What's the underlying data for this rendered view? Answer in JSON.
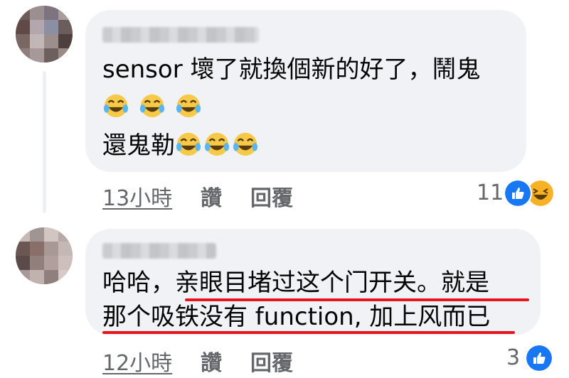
{
  "comments": [
    {
      "text_line_1": "sensor 壞了就換個新的好了，鬧鬼",
      "text_line_3_prefix": "還鬼勒",
      "emoji_name": "laughing-tears-emoji",
      "time": "13小時",
      "like_label": "讚",
      "reply_label": "回覆",
      "reaction_count": "11",
      "reactions": [
        "like-icon",
        "haha-icon"
      ]
    },
    {
      "text_line_1_prefix": "哈哈，",
      "text_line_1_underlined": "亲眼目堵过这个门开关。就是",
      "text_line_2": "那个吸铁没有 function, 加上风而已",
      "time": "12小時",
      "like_label": "讚",
      "reply_label": "回覆",
      "reaction_count": "3",
      "reactions": [
        "like-icon"
      ]
    }
  ],
  "colors": {
    "bubble": "#f0f2f5",
    "meta_text": "#65676b",
    "like_blue": "#1877f2",
    "haha_yellow": "#f7b125",
    "annotation_red": "#e8141e"
  }
}
